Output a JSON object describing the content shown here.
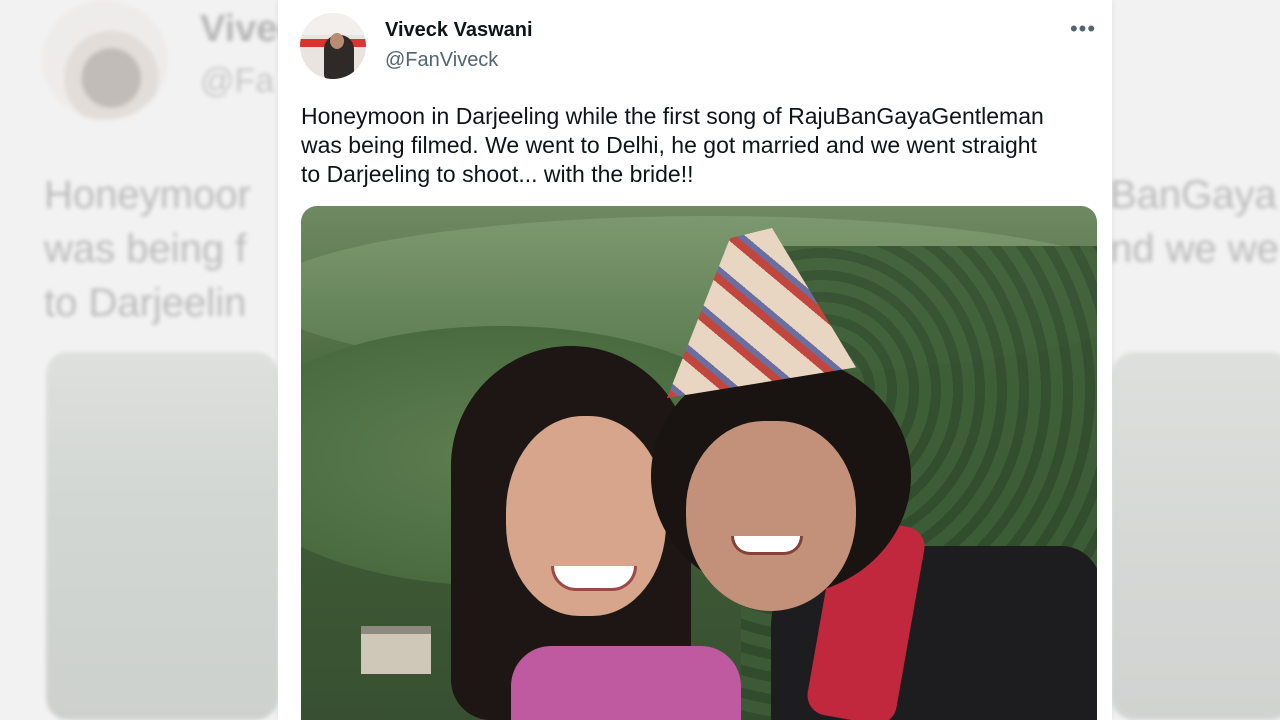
{
  "tweet": {
    "author_name": "Viveck Vaswani",
    "author_handle": "@FanViveck",
    "more_options": "•••",
    "text": "Honeymoon in Darjeeling while the first song of RajuBanGayaGentleman\nwas being filmed. We went to Delhi, he got married and we went straight\nto Darjeeling to shoot... with the bride!!"
  },
  "background": {
    "name_fragment": "Vivec",
    "handle_fragment": "@Fa",
    "text_left": "Honeymoor\nwas being f\nto Darjeelin",
    "text_right": "BanGaya\nnd we we"
  },
  "colors": {
    "text_primary": "#0f1419",
    "text_secondary": "#536471",
    "card_bg": "#ffffff",
    "page_bg": "#f2f2f2"
  }
}
